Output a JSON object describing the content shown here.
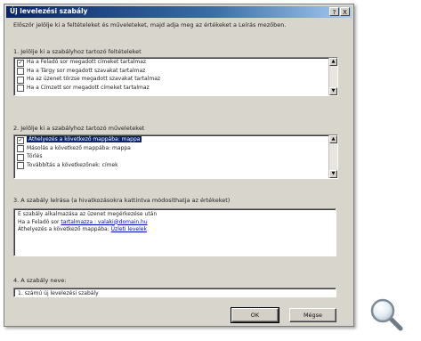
{
  "dialog": {
    "title": "Új levelezési szabály",
    "title_help": "?",
    "title_close": "X",
    "intro": "Először jelölje ki a feltételeket és műveleteket, majd adja meg az értékeket a Leírás mezőben."
  },
  "step1": {
    "label": "1. Jelölje ki a szabályhoz tartozó feltételeket",
    "items": [
      {
        "text": "Ha a Feladó sor megadott címeket tartalmaz",
        "checked": true
      },
      {
        "text": "Ha a Tárgy sor megadott szavakat tartalmaz",
        "checked": false
      },
      {
        "text": "Ha az üzenet törzse megadott szavakat tartalmaz",
        "checked": false
      },
      {
        "text": "Ha a Címzett sor megadott címeket tartalmaz",
        "checked": false
      }
    ]
  },
  "step2": {
    "label": "2. Jelölje ki a szabályhoz tartozó műveleteket",
    "items": [
      {
        "text": "Áthelyezés a következő mappába: mappa",
        "checked": true,
        "selected": true
      },
      {
        "text": "Másolás a következő mappába: mappa",
        "checked": false
      },
      {
        "text": "Törlés",
        "checked": false
      },
      {
        "text": "Továbbítás a következőnek: címek",
        "checked": false
      }
    ]
  },
  "step3": {
    "label": "3. A szabály leírása (a hivatkozásokra kattintva módosíthatja az értékeket)",
    "line1": "E szabály alkalmazása az üzenet megérkezése után",
    "line2_prefix": "Ha a Feladó sor ",
    "line2_link": "tartalmazza : valaki@domain.hu",
    "line3_prefix": "Áthelyezés a következő mappába: ",
    "line3_link": "Üzleti levelek"
  },
  "step4": {
    "label": "4. A szabály neve:",
    "value": "1. számú új levelezési szabály"
  },
  "buttons": {
    "ok": "OK",
    "cancel": "Mégse"
  },
  "icons": {
    "magnifier": "magnifier-icon"
  }
}
